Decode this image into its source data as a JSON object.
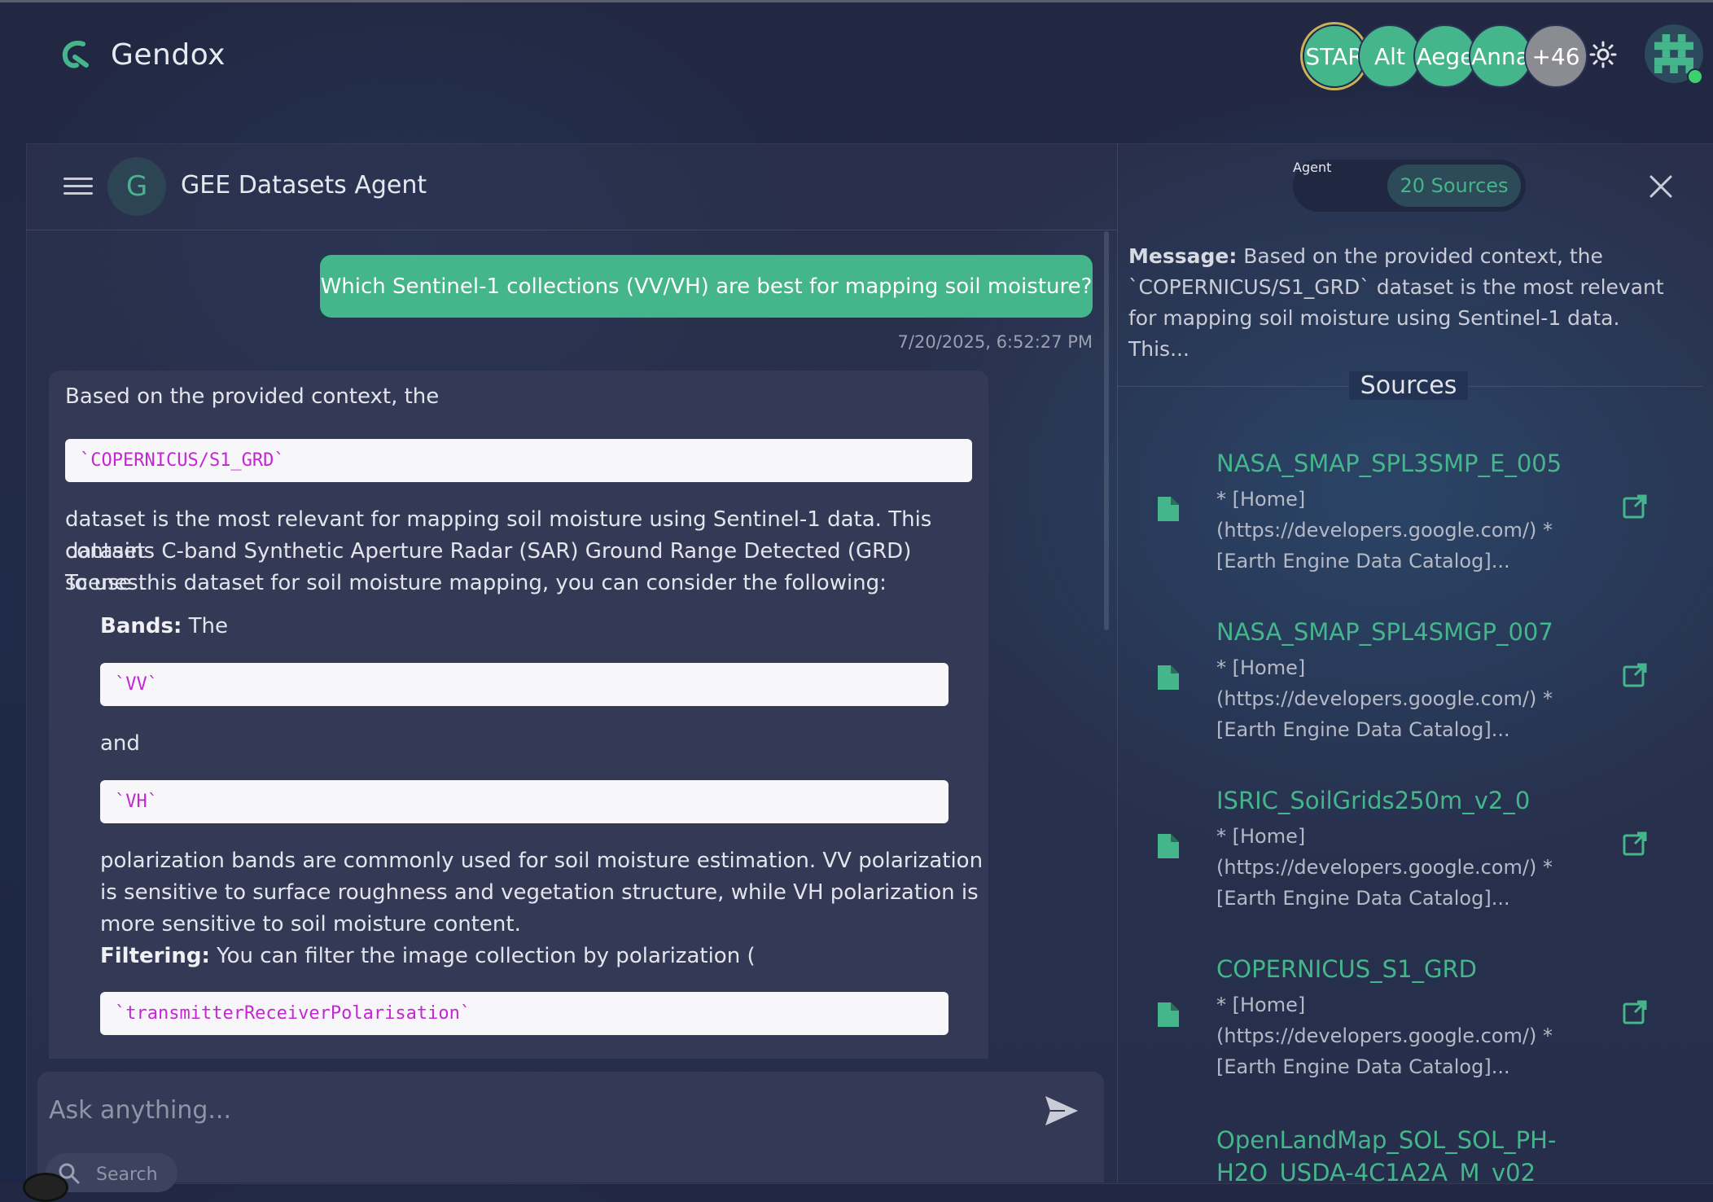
{
  "header": {
    "brand_name": "Gendox",
    "avatars": [
      {
        "label": "STAR",
        "color": "#45b58b"
      },
      {
        "label": "Alt",
        "color": "#45b58b"
      },
      {
        "label": "Aege",
        "color": "#45b58b"
      },
      {
        "label": "Anna",
        "color": "#45b58b"
      },
      {
        "label": "+46",
        "color": "#8a8c92"
      }
    ],
    "theme_icon": "sun-icon",
    "user_avatar_icon": "identicon-avatar"
  },
  "chat": {
    "agent_initial": "G",
    "agent_name": "GEE Datasets Agent",
    "user_message": "Which Sentinel-1 collections (VV/VH) are best for mapping soil moisture?",
    "timestamp": "7/20/2025, 6:52:27 PM",
    "response": {
      "intro": "Based on the provided context, the",
      "code_dataset": "`COPERNICUS/S1_GRD`",
      "para1_line1": "dataset is the most relevant for mapping soil moisture using Sentinel-1 data. This dataset",
      "para1_line2": "contains C-band Synthetic Aperture Radar (SAR) Ground Range Detected (GRD) scenes.",
      "para1_line3": "To use this dataset for soil moisture mapping, you can consider the following:",
      "bands_label": "Bands:",
      "bands_text": " The",
      "code_vv": "`VV`",
      "and_text": "and",
      "code_vh": "`VH`",
      "para2_line1": "polarization bands are commonly used for soil moisture estimation. VV polarization",
      "para2_line2": "is sensitive to surface roughness and vegetation structure, while VH polarization is",
      "para2_line3": "more sensitive to soil moisture content.",
      "filtering_label": "Filtering:",
      "filtering_text": " You can filter the image collection by polarization (",
      "code_polarisation": "`transmitterReceiverPolarisation`"
    },
    "input_placeholder": "Ask anything...",
    "search_label": "Search"
  },
  "side_panel": {
    "tab_agent": "Agent",
    "tab_sources": "20 Sources",
    "message_label": "Message:",
    "message_text": " Based on the provided context, the `COPERNICUS/S1_GRD` dataset is the most relevant for mapping soil moisture using Sentinel-1 data. This...",
    "sources_title": "Sources",
    "sources": [
      {
        "title": "NASA_SMAP_SPL3SMP_E_005",
        "desc": "* [Home] (https://developers.google.com/) * [Earth Engine Data Catalog]..."
      },
      {
        "title": "NASA_SMAP_SPL4SMGP_007",
        "desc": "* [Home] (https://developers.google.com/) * [Earth Engine Data Catalog]..."
      },
      {
        "title": "ISRIC_SoilGrids250m_v2_0",
        "desc": "* [Home] (https://developers.google.com/) * [Earth Engine Data Catalog]..."
      },
      {
        "title": "COPERNICUS_S1_GRD",
        "desc": "* [Home] (https://developers.google.com/) * [Earth Engine Data Catalog]..."
      },
      {
        "title": "OpenLandMap_SOL_SOL_PH-H2O_USDA-4C1A2A_M_v02",
        "desc": ""
      }
    ]
  },
  "colors": {
    "accent": "#45b58b",
    "code_text": "#c526d4",
    "bubble_bg": "#343a55"
  }
}
